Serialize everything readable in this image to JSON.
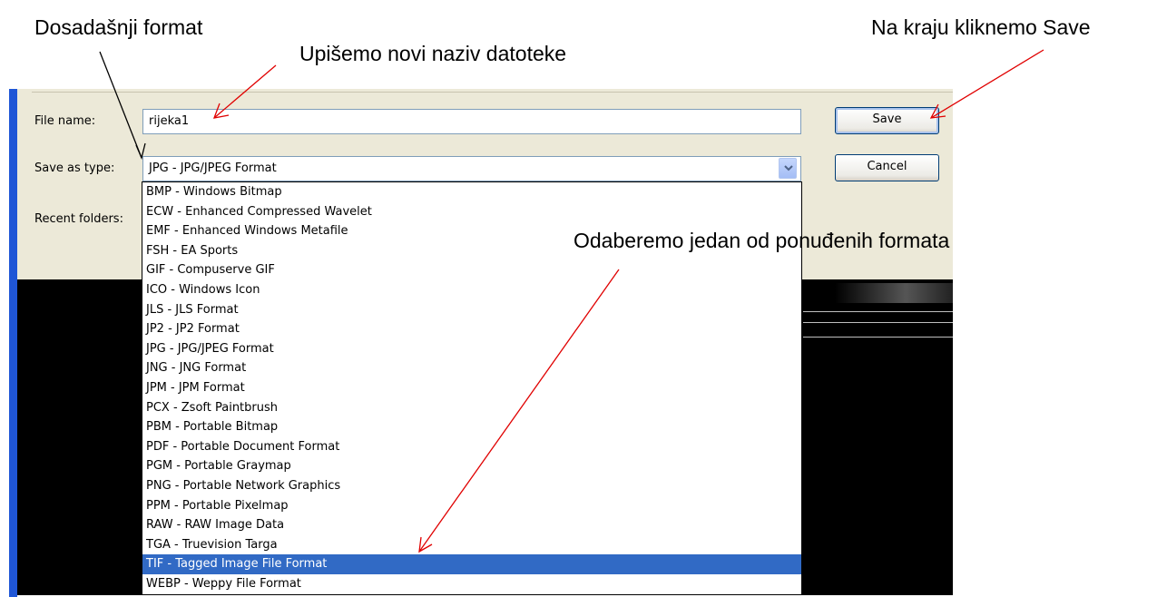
{
  "annotations": {
    "current_format": "Dosadašnji format",
    "new_filename": "Upišemo novi naziv datoteke",
    "click_save": "Na kraju kliknemo Save",
    "choose_format": "Odaberemo jedan od ponuđenih formata"
  },
  "dialog": {
    "file_name_label": "File name:",
    "file_name_value": "rijeka1",
    "save_as_type_label": "Save as type:",
    "save_as_type_value": "JPG - JPG/JPEG Format",
    "recent_folders_label": "Recent folders:",
    "save_label": "Save",
    "cancel_label": "Cancel"
  },
  "type_options": [
    "BMP - Windows Bitmap",
    "ECW - Enhanced Compressed Wavelet",
    "EMF - Enhanced Windows Metafile",
    "FSH - EA Sports",
    "GIF - Compuserve GIF",
    "ICO - Windows Icon",
    "JLS - JLS Format",
    "JP2 - JP2 Format",
    "JPG - JPG/JPEG Format",
    "JNG - JNG Format",
    "JPM - JPM Format",
    "PCX - Zsoft Paintbrush",
    "PBM - Portable Bitmap",
    "PDF - Portable Document Format",
    "PGM - Portable Graymap",
    "PNG - Portable Network Graphics",
    "PPM - Portable Pixelmap",
    "RAW - RAW Image Data",
    "TGA - Truevision Targa",
    "TIF - Tagged Image File Format",
    "WEBP - Weppy File Format"
  ],
  "selected_option": "TIF - Tagged Image File Format",
  "colors": {
    "selection": "#316ac5",
    "arrow": "#e00000",
    "dialog_bg": "#ece9d8"
  },
  "icons": {
    "combo_arrow": "chevron-down-icon"
  }
}
